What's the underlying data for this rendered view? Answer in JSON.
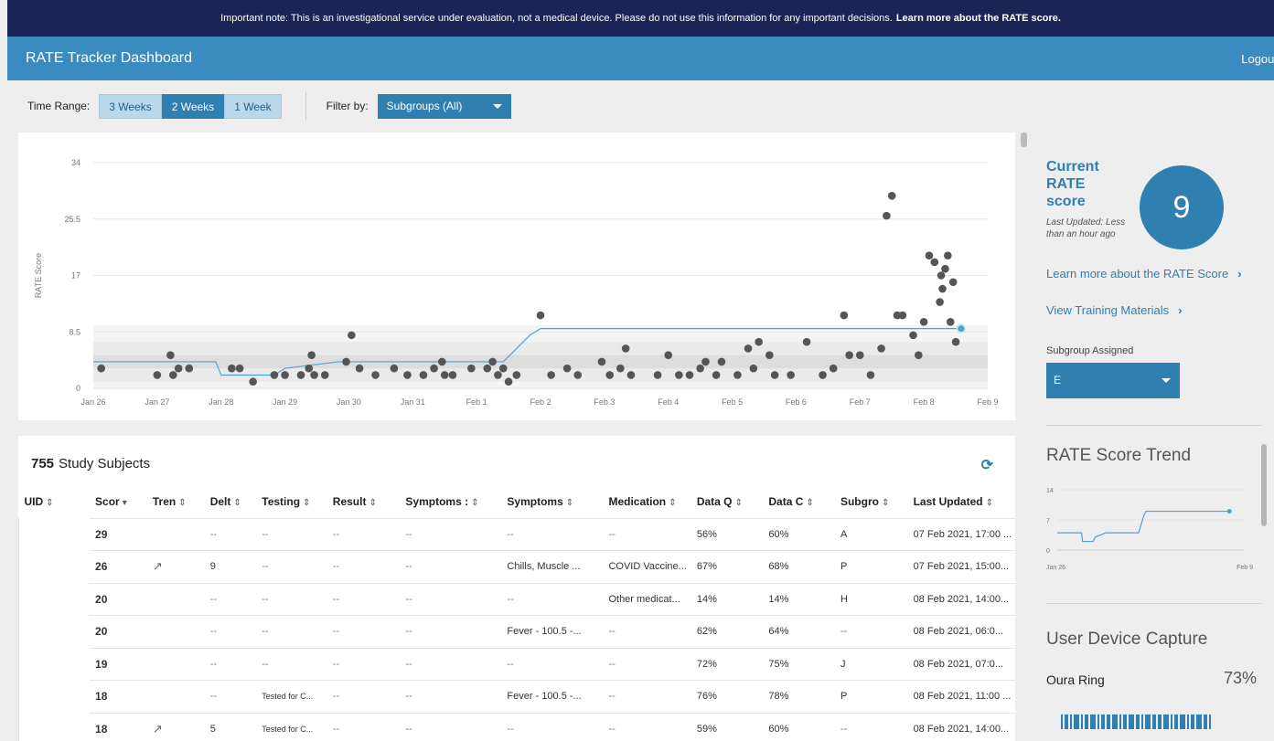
{
  "notice": {
    "text": "Important note: This is an investigational service under evaluation, not a medical device. Please do not use this information for any important decisions.",
    "link": "Learn more about the RATE score."
  },
  "header": {
    "title": "RATE Tracker Dashboard",
    "logout": "Logout"
  },
  "controls": {
    "time_range_label": "Time Range:",
    "time_options": [
      "3 Weeks",
      "2 Weeks",
      "1 Week"
    ],
    "time_selected": "2 Weeks",
    "filter_label": "Filter by:",
    "filter_value": "Subgroups (All)"
  },
  "colors": {
    "navy": "#1a2555",
    "accent": "#3a8bbf",
    "button": "#2f7fb1",
    "points": "#555555",
    "line": "#4ba3d0"
  },
  "chart_data": {
    "type": "scatter",
    "ylabel": "RATE Score",
    "yticks": [
      "0",
      "8.5",
      "17",
      "25.5",
      "34"
    ],
    "ylim": [
      0,
      34
    ],
    "xticks": [
      "Jan 26",
      "Jan 27",
      "Jan 28",
      "Jan 29",
      "Jan 30",
      "Jan 31",
      "Feb 1",
      "Feb 2",
      "Feb 3",
      "Feb 4",
      "Feb 5",
      "Feb 6",
      "Feb 7",
      "Feb 8",
      "Feb 9"
    ],
    "xlim": [
      "Jan 26",
      "Feb 9"
    ],
    "series": [
      {
        "values": [
          [
            "Jan 26 03:00",
            3
          ],
          [
            "Jan 27 00:00",
            2
          ],
          [
            "Jan 27 05:00",
            5
          ],
          [
            "Jan 27 06:00",
            2
          ],
          [
            "Jan 27 08:00",
            3
          ],
          [
            "Jan 27 12:00",
            3
          ],
          [
            "Jan 28 04:00",
            3
          ],
          [
            "Jan 28 07:00",
            3
          ],
          [
            "Jan 28 12:00",
            1
          ],
          [
            "Jan 28 20:00",
            2
          ],
          [
            "Jan 29 00:00",
            2
          ],
          [
            "Jan 29 06:00",
            2
          ],
          [
            "Jan 29 09:00",
            3
          ],
          [
            "Jan 29 10:00",
            5
          ],
          [
            "Jan 29 11:00",
            2
          ],
          [
            "Jan 29 15:00",
            2
          ],
          [
            "Jan 29 23:00",
            4
          ],
          [
            "Jan 30 01:00",
            8
          ],
          [
            "Jan 30 04:00",
            3
          ],
          [
            "Jan 30 10:00",
            2
          ],
          [
            "Jan 30 17:00",
            3
          ],
          [
            "Jan 30 22:00",
            2
          ],
          [
            "Jan 31 04:00",
            2
          ],
          [
            "Jan 31 08:00",
            3
          ],
          [
            "Jan 31 11:00",
            4
          ],
          [
            "Jan 31 12:00",
            2
          ],
          [
            "Jan 31 15:00",
            2
          ],
          [
            "Jan 31 22:00",
            3
          ],
          [
            "Feb 1 04:00",
            3
          ],
          [
            "Feb 1 06:00",
            4
          ],
          [
            "Feb 1 08:00",
            2
          ],
          [
            "Feb 1 10:00",
            3
          ],
          [
            "Feb 1 12:00",
            1
          ],
          [
            "Feb 1 15:00",
            2
          ],
          [
            "Feb 2 00:00",
            11
          ],
          [
            "Feb 2 04:00",
            2
          ],
          [
            "Feb 2 10:00",
            3
          ],
          [
            "Feb 2 14:00",
            2
          ],
          [
            "Feb 2 23:00",
            4
          ],
          [
            "Feb 3 02:00",
            2
          ],
          [
            "Feb 3 06:00",
            3
          ],
          [
            "Feb 3 08:00",
            6
          ],
          [
            "Feb 3 10:00",
            2
          ],
          [
            "Feb 3 20:00",
            2
          ],
          [
            "Feb 4 00:00",
            5
          ],
          [
            "Feb 4 04:00",
            2
          ],
          [
            "Feb 4 08:00",
            2
          ],
          [
            "Feb 4 12:00",
            3
          ],
          [
            "Feb 4 14:00",
            4
          ],
          [
            "Feb 4 18:00",
            2
          ],
          [
            "Feb 4 20:00",
            4
          ],
          [
            "Feb 5 02:00",
            2
          ],
          [
            "Feb 5 06:00",
            6
          ],
          [
            "Feb 5 08:00",
            3
          ],
          [
            "Feb 5 10:00",
            7
          ],
          [
            "Feb 5 14:00",
            5
          ],
          [
            "Feb 5 16:00",
            2
          ],
          [
            "Feb 5 22:00",
            2
          ],
          [
            "Feb 6 04:00",
            7
          ],
          [
            "Feb 6 10:00",
            2
          ],
          [
            "Feb 6 14:00",
            3
          ],
          [
            "Feb 6 18:00",
            11
          ],
          [
            "Feb 6 20:00",
            5
          ],
          [
            "Feb 7 00:00",
            5
          ],
          [
            "Feb 7 04:00",
            2
          ],
          [
            "Feb 7 08:00",
            6
          ],
          [
            "Feb 7 10:00",
            26
          ],
          [
            "Feb 7 12:00",
            29
          ],
          [
            "Feb 7 14:00",
            11
          ],
          [
            "Feb 7 16:00",
            11
          ],
          [
            "Feb 7 20:00",
            8
          ],
          [
            "Feb 7 22:00",
            5
          ],
          [
            "Feb 8 00:00",
            10
          ],
          [
            "Feb 8 02:00",
            20
          ],
          [
            "Feb 8 04:00",
            19
          ],
          [
            "Feb 8 06:00",
            13
          ],
          [
            "Feb 8 06:30",
            17
          ],
          [
            "Feb 8 07:00",
            15
          ],
          [
            "Feb 8 08:00",
            18
          ],
          [
            "Feb 8 09:00",
            20
          ],
          [
            "Feb 8 10:00",
            10
          ],
          [
            "Feb 8 11:00",
            16
          ],
          [
            "Feb 8 12:00",
            7
          ],
          [
            "Feb 8 14:00",
            9
          ]
        ]
      },
      {
        "values": [
          [
            "Jan 26",
            4
          ],
          [
            "Jan 27 22:00",
            4
          ],
          [
            "Jan 28 00:00",
            2
          ],
          [
            "Jan 28 20:00",
            2
          ],
          [
            "Jan 29 00:00",
            3
          ],
          [
            "Jan 29 20:00",
            4
          ],
          [
            "Feb 1 10:00",
            4
          ],
          [
            "Feb 1 20:00",
            8
          ],
          [
            "Feb 2 00:00",
            9
          ],
          [
            "Feb 8 14:00",
            9
          ]
        ]
      }
    ]
  },
  "table": {
    "count": "755",
    "title": "Study Subjects",
    "columns": [
      "UID",
      "Scor",
      "Tren",
      "Delt",
      "Testing",
      "Result",
      "Symptoms :",
      "Symptoms",
      "Medication",
      "Data Q",
      "Data C",
      "Subgro",
      "Last Updated"
    ],
    "rows": [
      {
        "score": "29",
        "trend": "",
        "delta": "--",
        "testing": "--",
        "results": "--",
        "symptoms1": "--",
        "symptoms2": "--",
        "medication": "--",
        "dataq": "56%",
        "datac": "60%",
        "subgroup": "A",
        "updated": "07 Feb 2021, 17:00 ..."
      },
      {
        "score": "26",
        "trend": "↗",
        "delta": "9",
        "testing": "--",
        "results": "--",
        "symptoms1": "--",
        "symptoms2": "Chills, Muscle ...",
        "medication": "COVID Vaccine...",
        "dataq": "67%",
        "datac": "68%",
        "subgroup": "P",
        "updated": "07 Feb 2021, 15:00..."
      },
      {
        "score": "20",
        "trend": "",
        "delta": "--",
        "testing": "--",
        "results": "--",
        "symptoms1": "--",
        "symptoms2": "--",
        "medication": "Other medicat...",
        "dataq": "14%",
        "datac": "14%",
        "subgroup": "H",
        "updated": "08 Feb 2021, 14:00..."
      },
      {
        "score": "20",
        "trend": "",
        "delta": "--",
        "testing": "--",
        "results": "--",
        "symptoms1": "--",
        "symptoms2": "Fever - 100.5 -...",
        "medication": "--",
        "dataq": "62%",
        "datac": "64%",
        "subgroup": "--",
        "updated": "08 Feb 2021, 06:0..."
      },
      {
        "score": "19",
        "trend": "",
        "delta": "--",
        "testing": "--",
        "results": "--",
        "symptoms1": "--",
        "symptoms2": "--",
        "medication": "--",
        "dataq": "72%",
        "datac": "75%",
        "subgroup": "J",
        "updated": "08 Feb 2021, 07:0..."
      },
      {
        "score": "18",
        "trend": "",
        "delta": "--",
        "testing": "Tested for C...",
        "results": "--",
        "symptoms1": "--",
        "symptoms2": "Fever - 100.5 -...",
        "medication": "--",
        "dataq": "76%",
        "datac": "78%",
        "subgroup": "P",
        "updated": "08 Feb 2021, 11:00 ..."
      },
      {
        "score": "18",
        "trend": "↗",
        "delta": "5",
        "testing": "Tested for C...",
        "results": "--",
        "symptoms1": "--",
        "symptoms2": "--",
        "medication": "--",
        "dataq": "59%",
        "datac": "60%",
        "subgroup": "--",
        "updated": "08 Feb 2021, 14:00..."
      }
    ]
  },
  "side": {
    "current_title": "Current RATE score",
    "last_updated": "Last Updated: Less than an hour ago",
    "score": "9",
    "learn_link": "Learn more about the RATE Score",
    "training_link": "View Training Materials",
    "subgroup_label": "Subgroup Assigned",
    "subgroup_value": "E",
    "trend_title": "RATE Score Trend",
    "trend_chart": {
      "type": "line",
      "yticks": [
        "0",
        "7",
        "14"
      ],
      "ylim": [
        0,
        14
      ],
      "xlabels": [
        "Jan 26",
        "Feb 9"
      ],
      "values": [
        [
          "Jan 26",
          4
        ],
        [
          "Jan 27 22:00",
          4
        ],
        [
          "Jan 28 00:00",
          2
        ],
        [
          "Jan 28 20:00",
          2
        ],
        [
          "Jan 29 00:00",
          3
        ],
        [
          "Jan 29 20:00",
          4
        ],
        [
          "Feb 1 10:00",
          4
        ],
        [
          "Feb 1 20:00",
          8
        ],
        [
          "Feb 2 00:00",
          9
        ],
        [
          "Feb 8 14:00",
          9
        ]
      ]
    },
    "device_title": "User Device Capture",
    "device_name": "Oura Ring",
    "device_pct": "73%"
  }
}
